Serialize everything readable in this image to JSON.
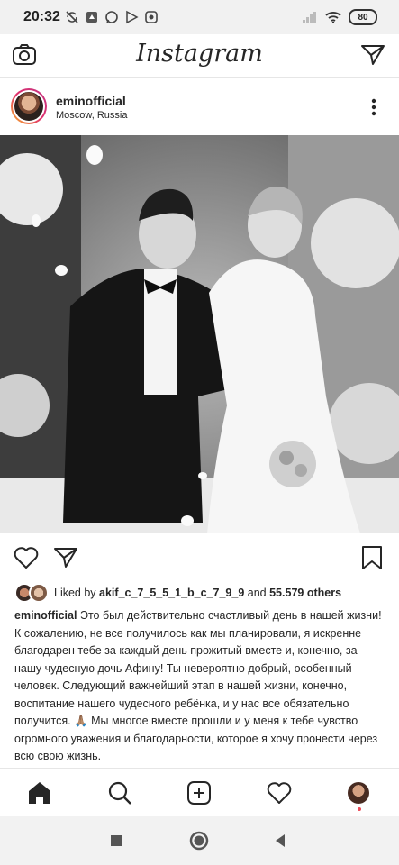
{
  "status_bar": {
    "time": "20:32",
    "battery": "80"
  },
  "header": {
    "logo": "Instagram"
  },
  "post": {
    "username": "eminofficial",
    "location": "Moscow, Russia",
    "likes": {
      "prefix": "Liked by ",
      "user": "akif_c_7_5_5_1_b_c_7_9_9",
      "middle": " and ",
      "count": "55.579 others"
    },
    "caption": {
      "author": "eminofficial",
      "text": "Это был действительно счастливый день в нашей жизни! К сожалению, не все получилось как мы планировали, я искренне благодарен тебе за каждый день прожитый вместе и, конечно, за нашу чудесную дочь Афину! Ты невероятно добрый, особенный человек. Следующий важнейший этап в нашей жизни, конечно, воспитание нашего чудесного ребёнка, и у нас все обязательно получится. 🙏🏽 Мы многое вместе прошли и у меня к тебе чувство огромного уважения и благодарности, которое я хочу пронести через всю свою жизнь."
    }
  },
  "icons": {
    "camera": "camera-icon",
    "direct": "direct-message-icon",
    "more": "more-vertical-icon",
    "like": "heart-icon",
    "share": "share-icon",
    "save": "bookmark-icon",
    "home": "home-icon",
    "search": "search-icon",
    "new_post": "new-post-icon",
    "activity": "heart-icon",
    "profile": "profile-avatar"
  },
  "colors": {
    "text": "#262626",
    "border": "#e6e6e6",
    "notification_dot": "#ed4956"
  }
}
